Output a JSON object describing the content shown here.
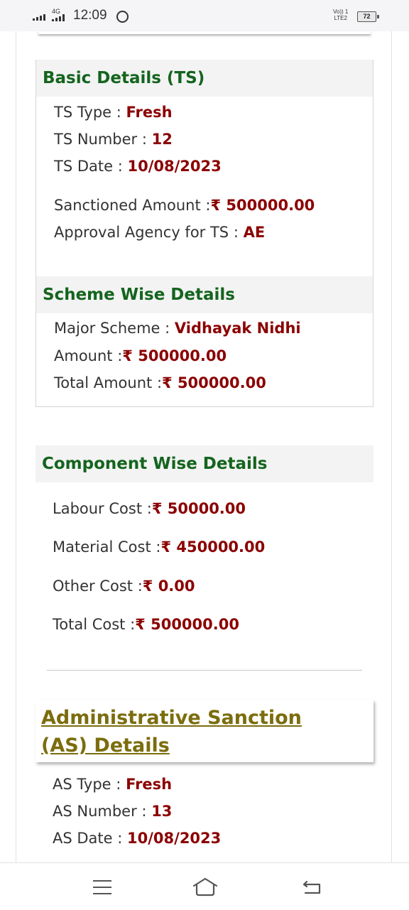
{
  "status_bar": {
    "time": "12:09",
    "network": "4G",
    "volte": "Vo)) 1\nLTE2",
    "battery": "72"
  },
  "basic_details": {
    "title": "Basic Details (TS)",
    "rows": [
      {
        "label": "TS Type",
        "value": "Fresh"
      },
      {
        "label": "TS Number",
        "value": "12"
      },
      {
        "label": "TS Date",
        "value": "10/08/2023"
      },
      {
        "label": "Sanctioned Amount",
        "value": "₹ 500000.00"
      },
      {
        "label": "Approval Agency for TS",
        "value": "AE"
      }
    ]
  },
  "scheme_details": {
    "title": "Scheme Wise Details",
    "rows": [
      {
        "label": "Major Scheme",
        "value": "Vidhayak Nidhi"
      },
      {
        "label": "Amount",
        "value": "₹ 500000.00"
      },
      {
        "label": "Total Amount",
        "value": "₹ 500000.00"
      }
    ]
  },
  "component_details": {
    "title": "Component Wise Details",
    "rows": [
      {
        "label": "Labour Cost",
        "value": "₹ 50000.00"
      },
      {
        "label": "Material Cost",
        "value": "₹ 450000.00"
      },
      {
        "label": "Other Cost",
        "value": "₹ 0.00"
      },
      {
        "label": "Total Cost",
        "value": "₹ 500000.00"
      }
    ]
  },
  "as_details": {
    "title": "Administrative Sanction (AS) Details",
    "rows": [
      {
        "label": "AS Type",
        "value": "Fresh"
      },
      {
        "label": "AS Number",
        "value": "13"
      },
      {
        "label": "AS Date",
        "value": "10/08/2023"
      }
    ]
  },
  "separator": ":",
  "nav": {
    "menu_icon": "menu-icon",
    "home_icon": "home-icon",
    "back_icon": "back-icon"
  }
}
